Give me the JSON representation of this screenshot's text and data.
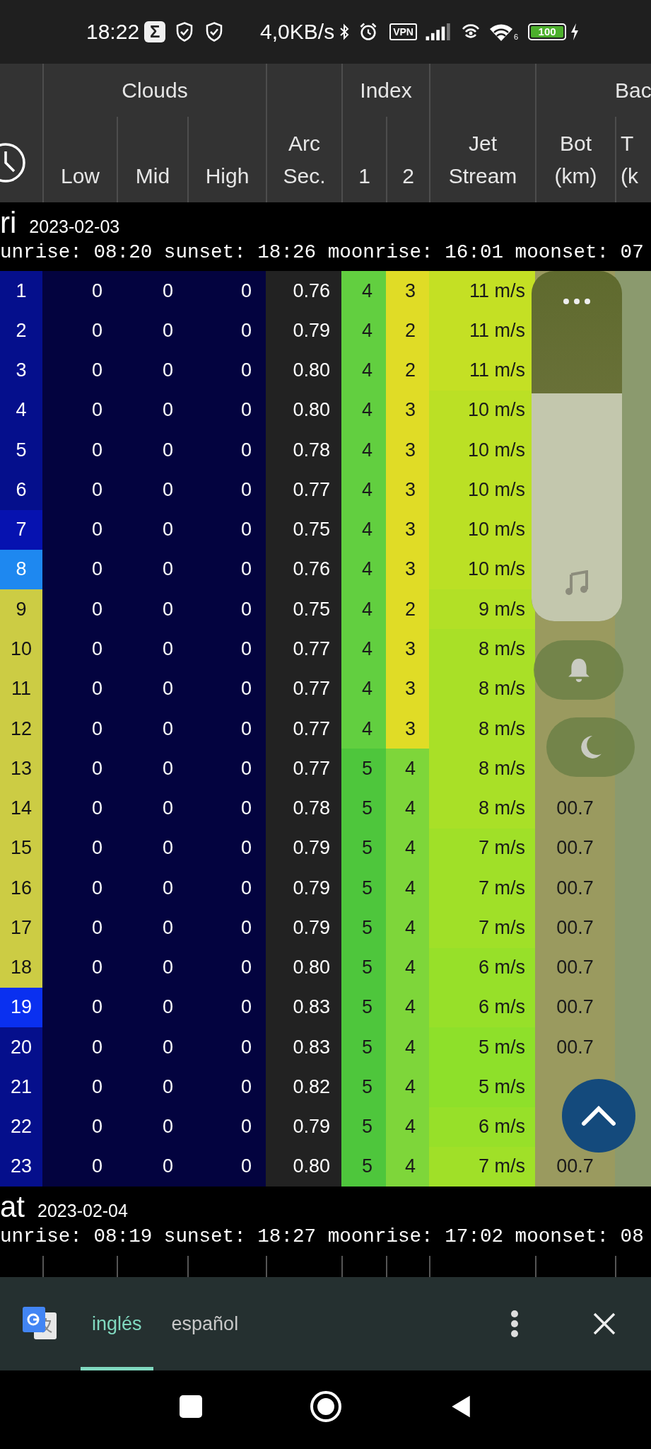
{
  "status_bar": {
    "time": "18:22",
    "app_badge": "Σ",
    "speed": "4,0KB/s",
    "vpn": "VPN",
    "wifi_band": "6",
    "battery": "100"
  },
  "table_header": {
    "groups": [
      {
        "label": "Clouds"
      },
      {
        "label": "Index"
      },
      {
        "label": "Bac"
      }
    ],
    "columns": [
      {
        "lines": [
          "Low"
        ]
      },
      {
        "lines": [
          "Mid"
        ]
      },
      {
        "lines": [
          "High"
        ]
      },
      {
        "lines": [
          "Arc",
          "Sec."
        ]
      },
      {
        "lines": [
          "1"
        ]
      },
      {
        "lines": [
          "2"
        ]
      },
      {
        "lines": [
          "Jet",
          "Stream"
        ]
      },
      {
        "lines": [
          "Bot",
          "(km)"
        ]
      },
      {
        "lines": [
          "T",
          "(k"
        ]
      }
    ]
  },
  "days": [
    {
      "day": "ri",
      "date": "2023-02-03",
      "sun": "unrise: 08:20 sunset: 18:26 moonrise: 16:01 moonset: 07",
      "rows": [
        {
          "hour": "1",
          "color": "#050f8c",
          "low": "0",
          "mid": "0",
          "high": "0",
          "arc": "0.76",
          "index_1": "4",
          "index_2": "3",
          "jet": "11 m/s"
        },
        {
          "hour": "2",
          "color": "#050f8c",
          "low": "0",
          "mid": "0",
          "high": "0",
          "arc": "0.79",
          "index_1": "4",
          "index_2": "2",
          "jet": "11 m/s"
        },
        {
          "hour": "3",
          "color": "#050f8c",
          "low": "0",
          "mid": "0",
          "high": "0",
          "arc": "0.80",
          "index_1": "4",
          "index_2": "2",
          "jet": "11 m/s"
        },
        {
          "hour": "4",
          "color": "#050f8c",
          "low": "0",
          "mid": "0",
          "high": "0",
          "arc": "0.80",
          "index_1": "4",
          "index_2": "3",
          "jet": "10 m/s"
        },
        {
          "hour": "5",
          "color": "#050f8c",
          "low": "0",
          "mid": "0",
          "high": "0",
          "arc": "0.78",
          "index_1": "4",
          "index_2": "3",
          "jet": "10 m/s"
        },
        {
          "hour": "6",
          "color": "#050f8c",
          "low": "0",
          "mid": "0",
          "high": "0",
          "arc": "0.77",
          "index_1": "4",
          "index_2": "3",
          "jet": "10 m/s"
        },
        {
          "hour": "7",
          "color": "#0612b0",
          "low": "0",
          "mid": "0",
          "high": "0",
          "arc": "0.75",
          "index_1": "4",
          "index_2": "3",
          "jet": "10 m/s"
        },
        {
          "hour": "8",
          "color": "#1e88f0",
          "low": "0",
          "mid": "0",
          "high": "0",
          "arc": "0.76",
          "index_1": "4",
          "index_2": "3",
          "jet": "10 m/s"
        },
        {
          "hour": "9",
          "color": "#cccc44",
          "low": "0",
          "mid": "0",
          "high": "0",
          "arc": "0.75",
          "index_1": "4",
          "index_2": "2",
          "jet": "9 m/s"
        },
        {
          "hour": "10",
          "color": "#cccc44",
          "low": "0",
          "mid": "0",
          "high": "0",
          "arc": "0.77",
          "index_1": "4",
          "index_2": "3",
          "jet": "8 m/s"
        },
        {
          "hour": "11",
          "color": "#cccc44",
          "low": "0",
          "mid": "0",
          "high": "0",
          "arc": "0.77",
          "index_1": "4",
          "index_2": "3",
          "jet": "8 m/s"
        },
        {
          "hour": "12",
          "color": "#cccc44",
          "low": "0",
          "mid": "0",
          "high": "0",
          "arc": "0.77",
          "index_1": "4",
          "index_2": "3",
          "jet": "8 m/s"
        },
        {
          "hour": "13",
          "color": "#cccc44",
          "low": "0",
          "mid": "0",
          "high": "0",
          "arc": "0.77",
          "index_1": "5",
          "index_2": "4",
          "jet": "8 m/s"
        },
        {
          "hour": "14",
          "color": "#cccc44",
          "low": "0",
          "mid": "0",
          "high": "0",
          "arc": "0.78",
          "index_1": "5",
          "index_2": "4",
          "jet": "8 m/s",
          "bot": "00.7"
        },
        {
          "hour": "15",
          "color": "#cccc44",
          "low": "0",
          "mid": "0",
          "high": "0",
          "arc": "0.79",
          "index_1": "5",
          "index_2": "4",
          "jet": "7 m/s",
          "bot": "00.7"
        },
        {
          "hour": "16",
          "color": "#cccc44",
          "low": "0",
          "mid": "0",
          "high": "0",
          "arc": "0.79",
          "index_1": "5",
          "index_2": "4",
          "jet": "7 m/s",
          "bot": "00.7"
        },
        {
          "hour": "17",
          "color": "#cccc44",
          "low": "0",
          "mid": "0",
          "high": "0",
          "arc": "0.79",
          "index_1": "5",
          "index_2": "4",
          "jet": "7 m/s",
          "bot": "00.7"
        },
        {
          "hour": "18",
          "color": "#cccc44",
          "low": "0",
          "mid": "0",
          "high": "0",
          "arc": "0.80",
          "index_1": "5",
          "index_2": "4",
          "jet": "6 m/s",
          "bot": "00.7"
        },
        {
          "hour": "19",
          "color": "#0a30f0",
          "low": "0",
          "mid": "0",
          "high": "0",
          "arc": "0.83",
          "index_1": "5",
          "index_2": "4",
          "jet": "6 m/s",
          "bot": "00.7"
        },
        {
          "hour": "20",
          "color": "#050f8c",
          "low": "0",
          "mid": "0",
          "high": "0",
          "arc": "0.83",
          "index_1": "5",
          "index_2": "4",
          "jet": "5 m/s",
          "bot": "00.7"
        },
        {
          "hour": "21",
          "color": "#050f8c",
          "low": "0",
          "mid": "0",
          "high": "0",
          "arc": "0.82",
          "index_1": "5",
          "index_2": "4",
          "jet": "5 m/s"
        },
        {
          "hour": "22",
          "color": "#050f8c",
          "low": "0",
          "mid": "0",
          "high": "0",
          "arc": "0.79",
          "index_1": "5",
          "index_2": "4",
          "jet": "6 m/s"
        },
        {
          "hour": "23",
          "color": "#050f8c",
          "low": "0",
          "mid": "0",
          "high": "0",
          "arc": "0.80",
          "index_1": "5",
          "index_2": "4",
          "jet": "7 m/s",
          "bot": "00.7"
        }
      ]
    },
    {
      "day": "at",
      "date": "2023-02-04",
      "sun": "unrise: 08:19 sunset: 18:27 moonrise: 17:02 moonset: 08"
    }
  ],
  "volume_panel": {
    "level": 0.65
  },
  "translate_bar": {
    "languages": [
      {
        "label": "inglés",
        "selected": true
      },
      {
        "label": "español",
        "selected": false
      }
    ]
  }
}
